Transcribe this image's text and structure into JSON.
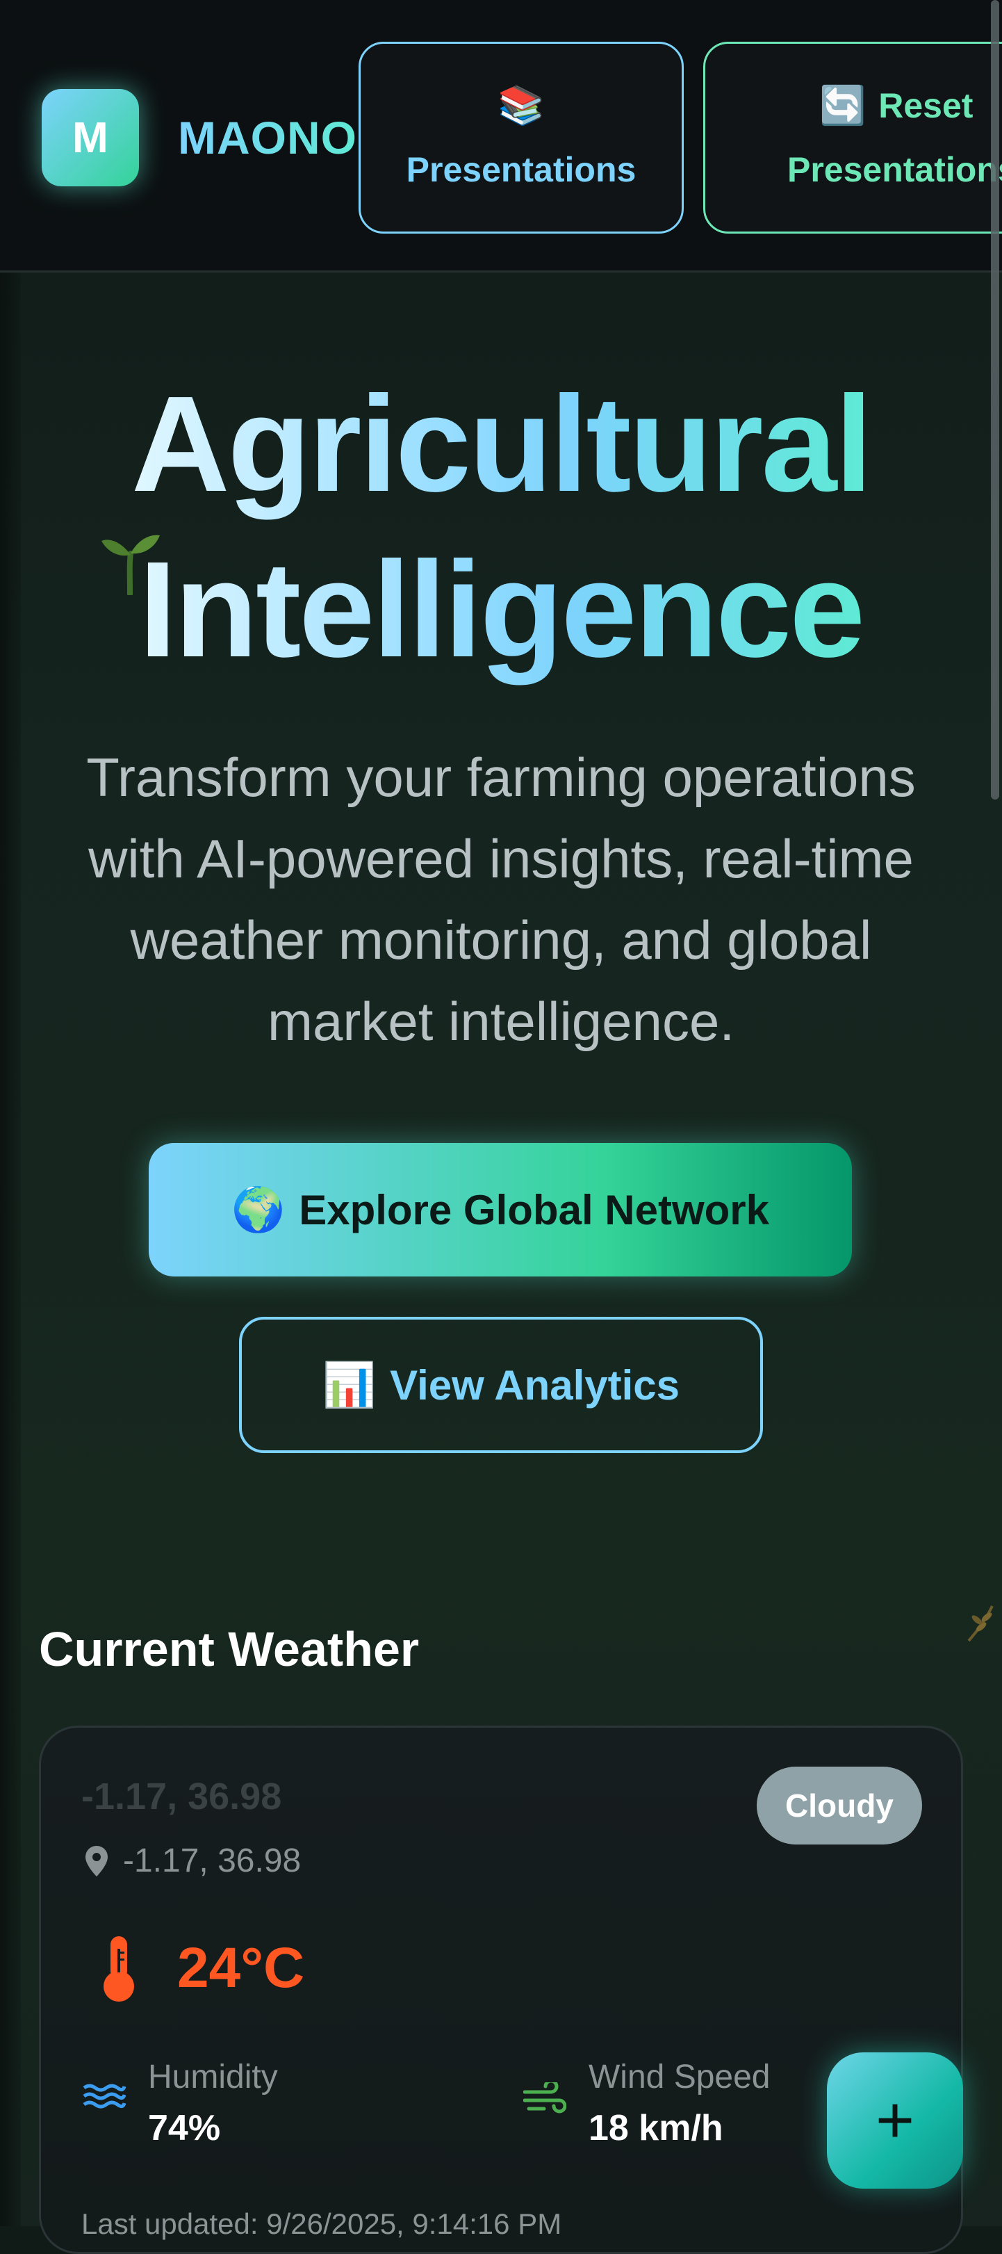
{
  "header": {
    "logo_letter": "M",
    "brand": "MAONO",
    "presentations_icon": "📚",
    "presentations_label": "Presentations",
    "reset_icon": "🔄",
    "reset_word": "Reset",
    "reset_label": "Presentations"
  },
  "hero": {
    "title_line1": "Agricultural",
    "title_line2": "Intelligence",
    "subtitle": "Transform your farming operations with AI-powered insights, real-time weather monitoring, and global market intelligence.",
    "primary_icon": "🌍",
    "primary_label": "Explore Global Network",
    "secondary_icon": "📊",
    "secondary_label": "View Analytics"
  },
  "weather": {
    "section_title": "Current Weather",
    "coords_title": "-1.17, 36.98",
    "coords": "-1.17, 36.98",
    "condition": "Cloudy",
    "temperature": "24°C",
    "humidity_label": "Humidity",
    "humidity_value": "74%",
    "wind_label": "Wind Speed",
    "wind_value": "18 km/h",
    "updated": "Last updated: 9/26/2025, 9:14:16 PM"
  },
  "fab": {
    "label": "+"
  },
  "colors": {
    "accent_blue": "#7dd3fc",
    "accent_green": "#34d399",
    "temperature": "#ff5722",
    "badge": "#8fa2a8"
  }
}
